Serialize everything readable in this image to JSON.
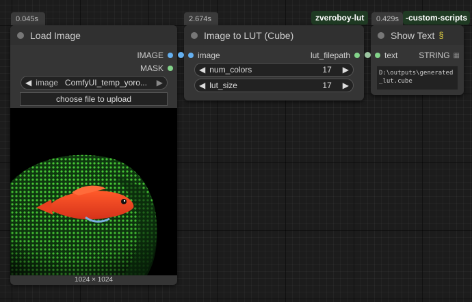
{
  "nodes": {
    "load_image": {
      "timing": "0.045s",
      "title": "Load Image",
      "outputs": [
        "IMAGE",
        "MASK"
      ],
      "image_widget": {
        "label": "image",
        "value": "ComfyUI_temp_yoro..."
      },
      "upload_label": "choose file to upload",
      "dimensions": "1024 × 1024"
    },
    "image_to_lut": {
      "timing": "2.674s",
      "title": "Image to LUT (Cube)",
      "input_label": "image",
      "output_label": "lut_filepath",
      "widgets": [
        {
          "label": "num_colors",
          "value": "17"
        },
        {
          "label": "lut_size",
          "value": "17"
        }
      ]
    },
    "show_text": {
      "timing": "0.429s",
      "title": "Show Text",
      "title_icon": "snake-icon",
      "input_label": "text",
      "output_label": "STRING",
      "text_value": "D:\\outputs\\generated_lut.cube"
    }
  },
  "badges": {
    "lut_pack": "zveroboy-lut",
    "scripts_pack": "-custom-scripts"
  },
  "colors": {
    "image_slot": "#65b0f0",
    "mask_slot": "#83d48a",
    "string_slot": "#9bc4a0",
    "badge_bg": "#1f3a23"
  }
}
